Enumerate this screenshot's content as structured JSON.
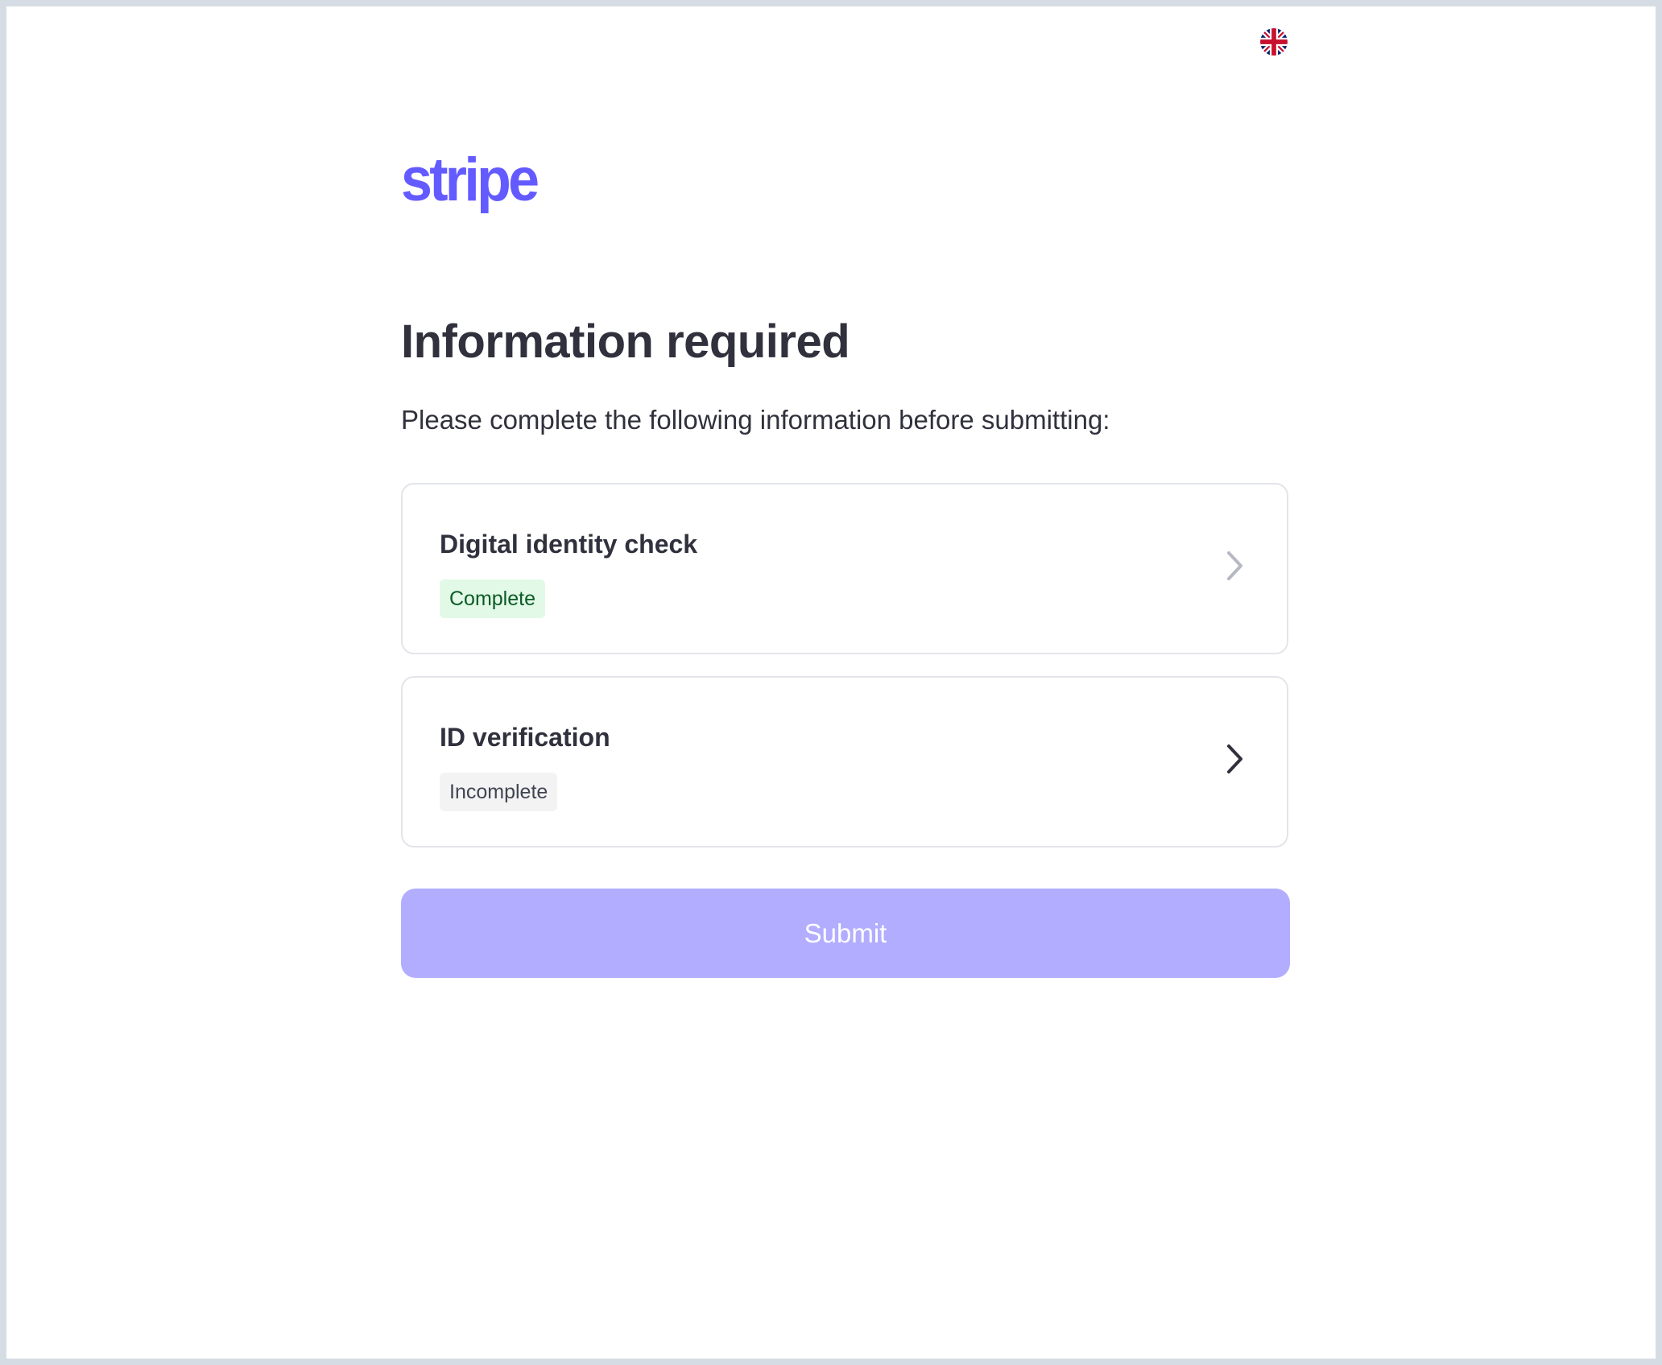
{
  "header": {
    "language_icon": "uk-flag-icon"
  },
  "brand": {
    "logo_text": "stripe",
    "color": "#635bff"
  },
  "page": {
    "title": "Information required",
    "subtitle": "Please complete the following information before submitting:"
  },
  "tasks": [
    {
      "label": "Digital identity check",
      "status": "Complete",
      "status_color": "#e1f9e6",
      "chevron_icon": "chevron-right-icon"
    },
    {
      "label": "ID verification",
      "status": "Incomplete",
      "status_color": "#f3f3f4",
      "chevron_icon": "chevron-right-icon"
    }
  ],
  "actions": {
    "submit_label": "Submit",
    "submit_color": "#b2adff"
  }
}
